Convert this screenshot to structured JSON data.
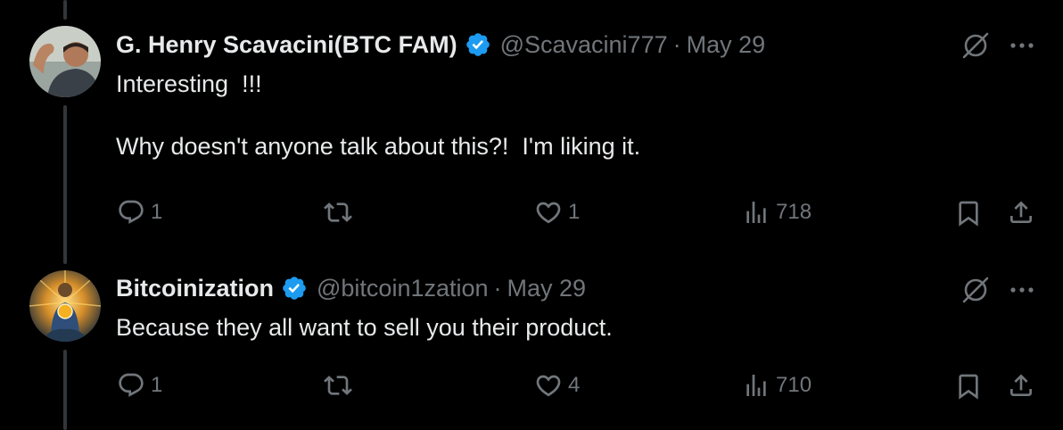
{
  "colors": {
    "background": "#000000",
    "text": "#e7e9ea",
    "muted": "#71767b",
    "verified": "#1d9bf0"
  },
  "tweets": [
    {
      "name": "G. Henry Scavacini(BTC FAM)",
      "handle": "@Scavacini777",
      "separator": "·",
      "date": "May 29",
      "text": "Interesting  !!!\n\nWhy doesn't anyone talk about this?!  I'm liking it.",
      "replies": "1",
      "reposts": "",
      "likes": "1",
      "views": "718",
      "icons": [
        "reply-icon",
        "repost-icon",
        "like-icon",
        "views-icon",
        "bookmark-icon",
        "share-icon",
        "grok-icon",
        "more-icon",
        "verified-badge-icon"
      ]
    },
    {
      "name": "Bitcoinization",
      "handle": "@bitcoin1zation",
      "separator": "·",
      "date": "May 29",
      "text": "Because they all want to sell you their product.",
      "replies": "1",
      "reposts": "",
      "likes": "4",
      "views": "710",
      "icons": [
        "reply-icon",
        "repost-icon",
        "like-icon",
        "views-icon",
        "bookmark-icon",
        "share-icon",
        "grok-icon",
        "more-icon",
        "verified-badge-icon"
      ]
    }
  ]
}
